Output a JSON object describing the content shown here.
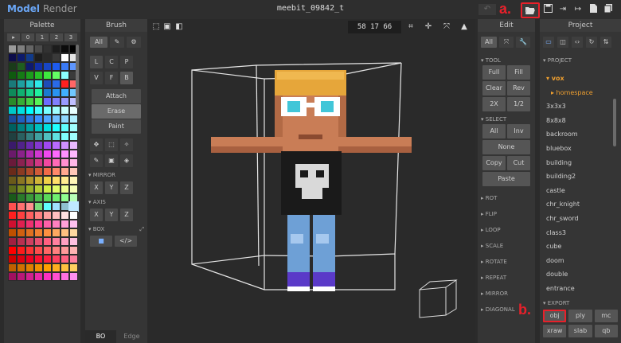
{
  "header": {
    "tabs": [
      "Model",
      "Render"
    ],
    "file_name": "meebit_09842_t"
  },
  "annotations": {
    "a": "a.",
    "b": "b."
  },
  "palette": {
    "title": "Palette",
    "tabs": [
      "▸",
      "0",
      "1",
      "2",
      "3"
    ],
    "colors": [
      "#9a9a9a",
      "#7f7f7f",
      "#656565",
      "#4b4b4b",
      "#323232",
      "#1c1c1c",
      "#0b0b0b",
      "#000000",
      "#0c0c4a",
      "#0c1a6b",
      "#103a8a",
      "#1d1d1d",
      "#2a2a2a",
      "#3a3a3a",
      "#ffffff",
      "#e4e4e4",
      "#1a3b1a",
      "#1f5d1f",
      "#0e1a6f",
      "#1230a8",
      "#1846c6",
      "#1e5cf0",
      "#3a7af5",
      "#5e96ff",
      "#0f5a0f",
      "#157a15",
      "#1c9c1c",
      "#26c226",
      "#3ee83e",
      "#64ff64",
      "#8affff",
      "#3a3a3a",
      "#1a7a7a",
      "#1ea0a0",
      "#26c4c4",
      "#2ee8e8",
      "#1e4cb8",
      "#2a6ae8",
      "#ff2020",
      "#ff6666",
      "#0e8a5a",
      "#10b070",
      "#18d08a",
      "#20f0a0",
      "#1a7ad0",
      "#2894f0",
      "#40b0ff",
      "#70c8ff",
      "#2a8a2a",
      "#36ad36",
      "#44cf44",
      "#57f057",
      "#6c6cff",
      "#8080ff",
      "#9a9aff",
      "#c0c0ff",
      "#00c8c8",
      "#00e0e0",
      "#00ffff",
      "#40ffff",
      "#78ffff",
      "#a0ffff",
      "#c8ffff",
      "#e8ffff",
      "#1a4a9a",
      "#2060c0",
      "#2a78e0",
      "#3a90ff",
      "#50a8ff",
      "#70c0ff",
      "#90d8ff",
      "#b0f0ff",
      "#006060",
      "#008080",
      "#00a0a0",
      "#00c0c0",
      "#00e0e0",
      "#20ffff",
      "#60ffff",
      "#a0ffff",
      "#204040",
      "#2a6060",
      "#358080",
      "#40a0a0",
      "#50c0c0",
      "#60e0e0",
      "#80ffff",
      "#a0ffff",
      "#3a1a6a",
      "#50228a",
      "#6a2ab0",
      "#8438d0",
      "#a048f0",
      "#b86aff",
      "#d090ff",
      "#e8b8ff",
      "#6a1a6a",
      "#8a228a",
      "#b02ab0",
      "#d038d0",
      "#f048f0",
      "#ff6aff",
      "#ff90ff",
      "#ffb8ff",
      "#6a1a3a",
      "#8a2250",
      "#b02a6a",
      "#d03884",
      "#f048a0",
      "#ff6ab8",
      "#ff90d0",
      "#ffb8e8",
      "#6a2a1a",
      "#8a3a22",
      "#b04a2a",
      "#d05a38",
      "#f06a48",
      "#ff886a",
      "#ffa890",
      "#ffc8b8",
      "#6a5a1a",
      "#8a7622",
      "#b0962a",
      "#d0b438",
      "#f0d048",
      "#ffe06a",
      "#ffec90",
      "#fff6b8",
      "#5a6a1a",
      "#768a22",
      "#96b02a",
      "#b4d038",
      "#d0f048",
      "#e0ff6a",
      "#ecff90",
      "#f6ffb8",
      "#1a5a1a",
      "#2a7a2a",
      "#3a9a3a",
      "#4aba4a",
      "#5ada5a",
      "#70f070",
      "#90ff90",
      "#b8ffb8",
      "#ff5050",
      "#ff7070",
      "#ff9090",
      "#7adc7a",
      "#60ffff",
      "#a0e0ff",
      "#90c0d0",
      "#bfe9ff",
      "#ff2020",
      "#ff4040",
      "#ff6060",
      "#ff8080",
      "#ffa0a0",
      "#ffc0c0",
      "#ffe0e0",
      "#ffffff",
      "#d01030",
      "#e02050",
      "#f03070",
      "#ff4090",
      "#ff60a8",
      "#ff80c0",
      "#ffa0d8",
      "#ffc0f0",
      "#c05000",
      "#d06010",
      "#e07020",
      "#f08030",
      "#ff9040",
      "#ffa860",
      "#ffc080",
      "#ffd8a0",
      "#a02040",
      "#b83050",
      "#d04060",
      "#e85070",
      "#ff6080",
      "#ff80a0",
      "#ffa0c0",
      "#ffc0e0",
      "#ff0000",
      "#ff1a1a",
      "#ff3333",
      "#ff4d4d",
      "#ff6666",
      "#ff8080",
      "#ff9999",
      "#ffb3b3",
      "#d00000",
      "#e00010",
      "#f00020",
      "#ff1030",
      "#ff2040",
      "#ff4060",
      "#ff6080",
      "#ff80a0",
      "#c06000",
      "#d07000",
      "#e08000",
      "#f09000",
      "#ffa000",
      "#ffb020",
      "#ffc040",
      "#ffd060",
      "#a01060",
      "#b81878",
      "#d02090",
      "#e828a8",
      "#ff30c0",
      "#ff50d0",
      "#ff70e0",
      "#ff90f0"
    ]
  },
  "brush": {
    "title": "Brush",
    "top_row": [
      "All",
      "✎",
      "⚙"
    ],
    "modes_row1": [
      "L",
      "C",
      "P"
    ],
    "modes_row2": [
      "V",
      "F",
      "B"
    ],
    "actions": [
      "Attach",
      "Erase",
      "Paint"
    ],
    "tools_row1": [
      "✥",
      "⬚",
      "✧"
    ],
    "tools_row2": [
      "✎",
      "▣",
      "◈"
    ],
    "mirror_label": "MIRROR",
    "mirror": [
      "X",
      "Y",
      "Z"
    ],
    "axis_label": "AXIS",
    "axis": [
      "X",
      "Y",
      "Z"
    ],
    "box_label": "BOX",
    "box_row": [
      "■",
      "</>"
    ],
    "bottom_tabs": [
      "BO",
      "Edge"
    ]
  },
  "viewport": {
    "coords": "58 17 66"
  },
  "edit": {
    "title": "Edit",
    "top_row": [
      "All",
      "⤧",
      "🔧"
    ],
    "tool_label": "TOOL",
    "tool_rows": [
      [
        "Full",
        "Fill"
      ],
      [
        "Clear",
        "Rev"
      ],
      [
        "2X",
        "1/2"
      ]
    ],
    "select_label": "SELECT",
    "select_rows": [
      [
        "All",
        "Inv"
      ],
      [
        "None"
      ],
      [
        "Copy",
        "Cut"
      ],
      [
        "Paste"
      ]
    ],
    "folds": [
      "ROT",
      "FLIP",
      "LOOP",
      "SCALE",
      "ROTATE",
      "REPEAT",
      "MIRROR",
      "DIAGONAL"
    ]
  },
  "project": {
    "title": "Project",
    "section_label": "PROJECT",
    "items": [
      {
        "name": "vox",
        "type": "folder"
      },
      {
        "name": "homespace",
        "type": "sub"
      },
      {
        "name": "3x3x3",
        "type": "file"
      },
      {
        "name": "8x8x8",
        "type": "file"
      },
      {
        "name": "backroom",
        "type": "file"
      },
      {
        "name": "bluebox",
        "type": "file"
      },
      {
        "name": "building",
        "type": "file"
      },
      {
        "name": "building2",
        "type": "file"
      },
      {
        "name": "castle",
        "type": "file"
      },
      {
        "name": "chr_knight",
        "type": "file"
      },
      {
        "name": "chr_sword",
        "type": "file"
      },
      {
        "name": "class3",
        "type": "file"
      },
      {
        "name": "cube",
        "type": "file"
      },
      {
        "name": "doom",
        "type": "file"
      },
      {
        "name": "double",
        "type": "file"
      },
      {
        "name": "entrance",
        "type": "file"
      }
    ],
    "export_label": "EXPORT",
    "export": [
      "obj",
      "ply",
      "mc",
      "xraw",
      "slab",
      "qb"
    ]
  }
}
